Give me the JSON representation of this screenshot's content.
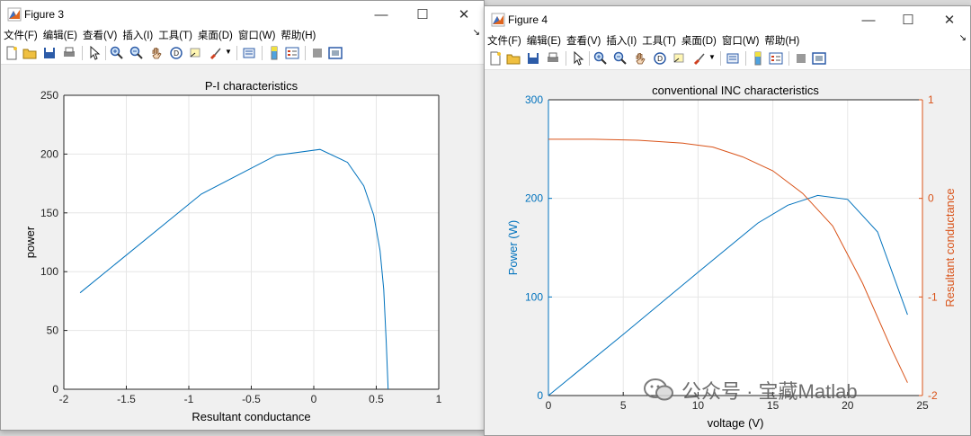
{
  "windows": [
    {
      "title": "Figure 3",
      "menus": [
        "文件(F)",
        "编辑(E)",
        "查看(V)",
        "插入(I)",
        "工具(T)",
        "桌面(D)",
        "窗口(W)",
        "帮助(H)"
      ],
      "chart": {
        "title": "P-I characteristics",
        "xlabel": "Resultant conductance",
        "ylabel": "power",
        "xticks": [
          "-2",
          "-1.5",
          "-1",
          "-0.5",
          "0",
          "0.5",
          "1"
        ],
        "yticks": [
          "0",
          "50",
          "100",
          "150",
          "200",
          "250"
        ]
      }
    },
    {
      "title": "Figure 4",
      "menus": [
        "文件(F)",
        "编辑(E)",
        "查看(V)",
        "插入(I)",
        "工具(T)",
        "桌面(D)",
        "窗口(W)",
        "帮助(H)"
      ],
      "chart": {
        "title": "conventional INC characteristics",
        "xlabel": "voltage (V)",
        "ylabel_left": "Power (W)",
        "ylabel_right": "Resultant conductance",
        "xticks": [
          "0",
          "5",
          "10",
          "15",
          "20",
          "25"
        ],
        "yticks_left": [
          "0",
          "100",
          "200",
          "300"
        ],
        "yticks_right": [
          "-2",
          "-1",
          "0",
          "1"
        ]
      }
    }
  ],
  "watermark": {
    "text": "公众号 · 宝藏Matlab"
  },
  "colors": {
    "blue": "#0072BD",
    "orange": "#D95319",
    "axis": "#262626",
    "grid": "#e6e6e6"
  },
  "chart_data": [
    {
      "type": "line",
      "title": "P-I characteristics",
      "xlabel": "Resultant conductance",
      "ylabel": "power",
      "xlim": [
        -2,
        1
      ],
      "ylim": [
        0,
        250
      ],
      "grid": true,
      "series": [
        {
          "x": [
            -1.87,
            -0.9,
            -0.3,
            0.05,
            0.27,
            0.4,
            0.48,
            0.53,
            0.56,
            0.58,
            0.595
          ],
          "y": [
            82,
            166,
            199,
            204,
            193,
            173,
            148,
            118,
            85,
            40,
            0
          ]
        }
      ]
    },
    {
      "type": "line",
      "title": "conventional INC characteristics",
      "xlabel": "voltage (V)",
      "ylabel_left": "Power (W)",
      "ylabel_right": "Resultant conductance",
      "xlim": [
        0,
        25
      ],
      "ylim_left": [
        0,
        300
      ],
      "ylim_right": [
        -2,
        1
      ],
      "grid": true,
      "series": [
        {
          "axis": "left",
          "x": [
            0,
            5,
            10,
            14,
            16,
            18,
            20,
            22,
            24
          ],
          "y": [
            0,
            62,
            125,
            175,
            193,
            203,
            199,
            166,
            82
          ]
        },
        {
          "axis": "right",
          "x": [
            0,
            3,
            6,
            9,
            11,
            13,
            15,
            17,
            19,
            21,
            23,
            24
          ],
          "y": [
            0.6,
            0.6,
            0.59,
            0.56,
            0.52,
            0.42,
            0.28,
            0.05,
            -0.28,
            -0.86,
            -1.55,
            -1.87
          ]
        }
      ]
    }
  ]
}
